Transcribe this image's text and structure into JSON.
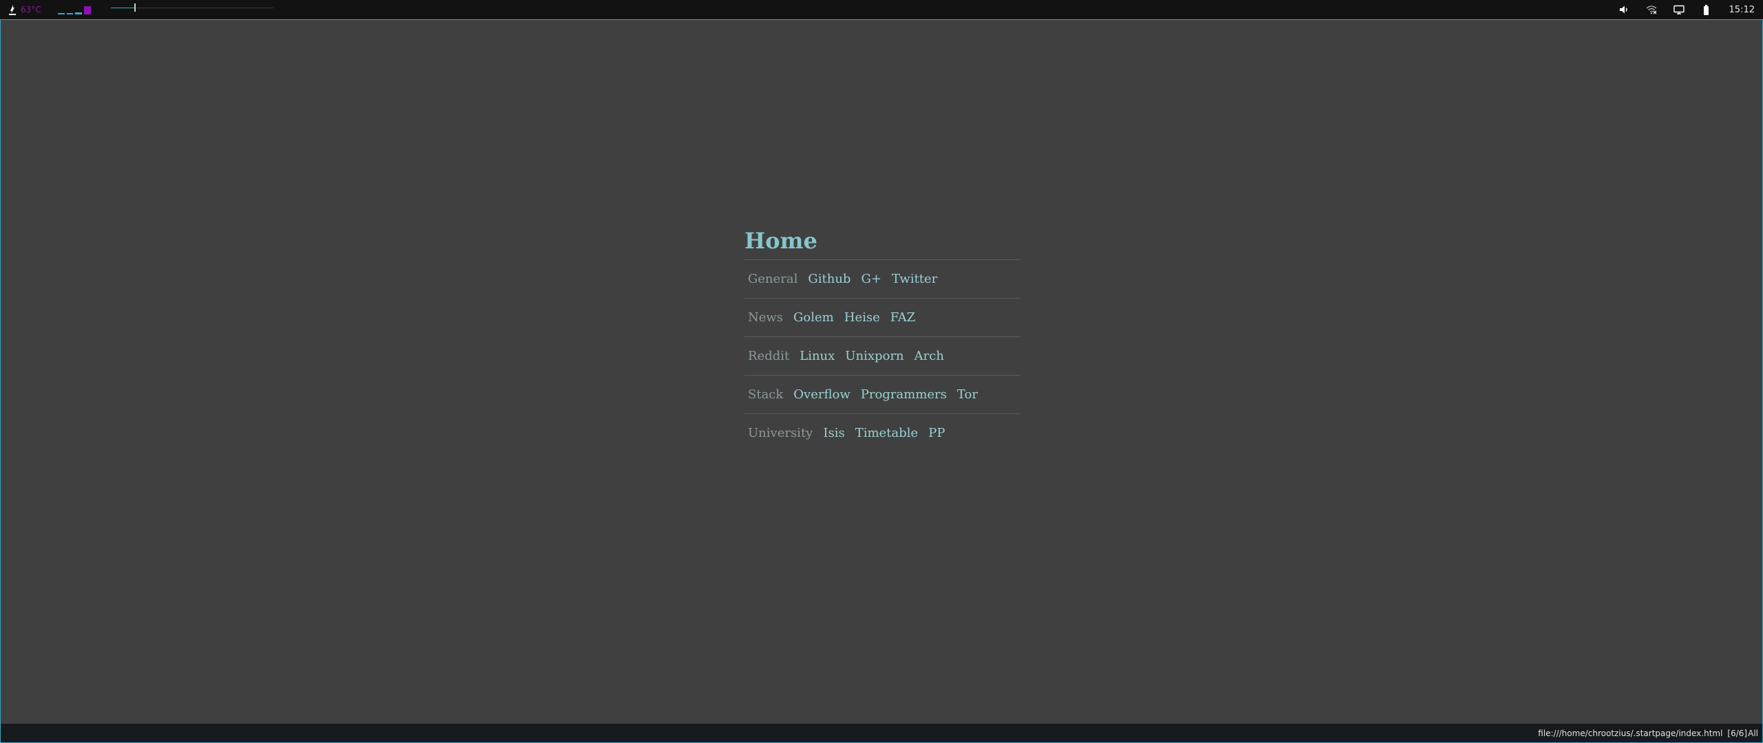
{
  "topbar": {
    "temperature": "63°C",
    "workspaces_active_index": 3,
    "media_progress": 0.15,
    "clock": "15:12",
    "tray_icons": [
      "volume-icon",
      "wifi-icon",
      "display-icon",
      "battery-icon"
    ]
  },
  "startpage": {
    "title": "Home",
    "rows": [
      {
        "category": "General",
        "links": [
          "Github",
          "G+",
          "Twitter"
        ]
      },
      {
        "category": "News",
        "links": [
          "Golem",
          "Heise",
          "FAZ"
        ]
      },
      {
        "category": "Reddit",
        "links": [
          "Linux",
          "Unixporn",
          "Arch"
        ]
      },
      {
        "category": "Stack",
        "links": [
          "Overflow",
          "Programmers",
          "Tor"
        ]
      },
      {
        "category": "University",
        "links": [
          "Isis",
          "Timetable",
          "PP"
        ]
      }
    ]
  },
  "statusbar": {
    "url": "file:///home/chrootzius/.startpage/index.html",
    "position": "[6/6]",
    "scroll": "All"
  },
  "colors": {
    "accent": "#3aa6c8",
    "workspace_active": "#8e12b8",
    "temperature": "#8a1a9a",
    "title": "#86c6cc",
    "link": "#9ad0d4",
    "category": "#8a9a9c",
    "page_background": "#404040",
    "panel_background": "#121212"
  }
}
